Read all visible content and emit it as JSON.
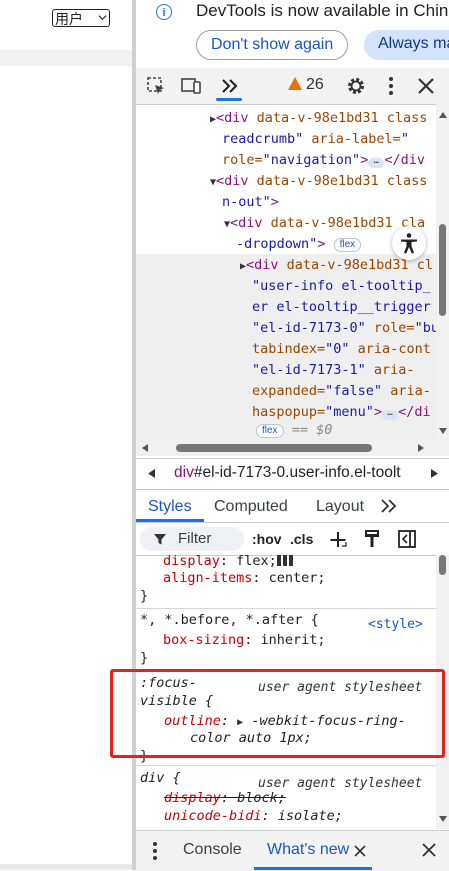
{
  "page": {
    "user_dropdown_label": "用户",
    "user_dropdown_icon": "chevron-down-icon"
  },
  "infobar": {
    "icon": "info-icon",
    "message": "DevTools is now available in Chin",
    "dont_show_label": "Don't show again",
    "always_label": "Always ma"
  },
  "toolbar": {
    "inspect_icon": "inspect-element-icon",
    "device_icon": "device-toolbar-icon",
    "more_panels_icon": "chevrons-right-icon",
    "issues_count": "26",
    "settings_icon": "gear-icon",
    "more_icon": "kebab-menu-icon",
    "close_icon": "close-icon"
  },
  "elements": {
    "lines": [
      {
        "l1": "<div",
        "a1": " data-v-98e1bd31",
        "a2": " class"
      },
      {
        "l2": "readcrumb\"",
        "a3": " aria-label=",
        "l2b": "\""
      },
      {
        "a4": "role=",
        "v4": "\"navigation\"",
        "t4": ">",
        "t4b": "</div"
      },
      {
        "l5": "<div",
        "a5": " data-v-98e1bd31",
        "a5b": " class"
      },
      {
        "v6": "n-out\"",
        "t6": ">"
      },
      {
        "l7": "<div",
        "a7": " data-v-98e1bd31",
        "a7b": " cla"
      },
      {
        "v8": "-dropdown\"",
        "t8": ">",
        "b8": "flex"
      },
      {
        "l9": "<div",
        "a9": " data-v-98e1bd31",
        "a9b": " cl"
      },
      {
        "v10": "\"user-info el-tooltip_"
      },
      {
        "v11": "er el-tooltip__trigger"
      },
      {
        "v12": "\"el-id-7173-0\"",
        "a12": " role=",
        "v12b": "\"bu"
      },
      {
        "a13": "tabindex=",
        "v13": "\"0\"",
        "a13b": " aria-cont"
      },
      {
        "v14": "\"el-id-7173-1\"",
        "a14": " aria-"
      },
      {
        "a15": "expanded=",
        "v15": "\"false\"",
        "a15b": " aria-"
      },
      {
        "a16": "haspopup=",
        "v16": "\"menu\"",
        "t16": ">",
        "t16b": "</di"
      },
      {
        "b17": "flex",
        "t17": " == $0"
      }
    ],
    "accessibility_icon": "accessibility-icon"
  },
  "breadcrumb": {
    "tag": "div",
    "rest": "#el-id-7173-0.user-info.el-toolt"
  },
  "sidebar_tabs": {
    "styles": "Styles",
    "computed": "Computed",
    "layout": "Layout",
    "more_icon": "chevrons-right-icon"
  },
  "filter": {
    "placeholder": "Filter",
    "hov": ":hov",
    "cls": ".cls",
    "add_icon": "plus-icon",
    "paint_icon": "paint-brush-icon",
    "sidebar_icon": "toggle-sidebar-icon"
  },
  "styles": {
    "rule1": {
      "p1": "display",
      "v1": ": flex;",
      "p2": "align-items",
      "v2": ": center;",
      "close": "}"
    },
    "rule2": {
      "selector": "*, *.before, *.after {",
      "origin": "<style>",
      "p1": "box-sizing",
      "v1": ": inherit;",
      "close": "}"
    },
    "rule3": {
      "selector1": ":focus-",
      "selector2": "visible {",
      "origin": "user agent stylesheet",
      "p1": "outline",
      "v1": "-webkit-focus-ring-",
      "v1b": "color auto 1px;",
      "close": "}"
    },
    "rule4": {
      "selector": "div {",
      "origin": "user agent stylesheet",
      "p1": "display",
      "v1": ": block;",
      "p2": "unicode-bidi",
      "v2": ": isolate;"
    }
  },
  "drawer": {
    "menu_icon": "kebab-menu-icon",
    "console": "Console",
    "whats_new": "What's new",
    "close_tab_icon": "close-icon",
    "close_icon": "close-icon"
  },
  "colors": {
    "accent": "#1a73e8",
    "tag": "#881280",
    "attr_name": "#994500",
    "attr_value": "#1a1aa6",
    "css_prop": "#c80000",
    "highlight_border": "#e3231a",
    "warning": "#e8710a"
  }
}
